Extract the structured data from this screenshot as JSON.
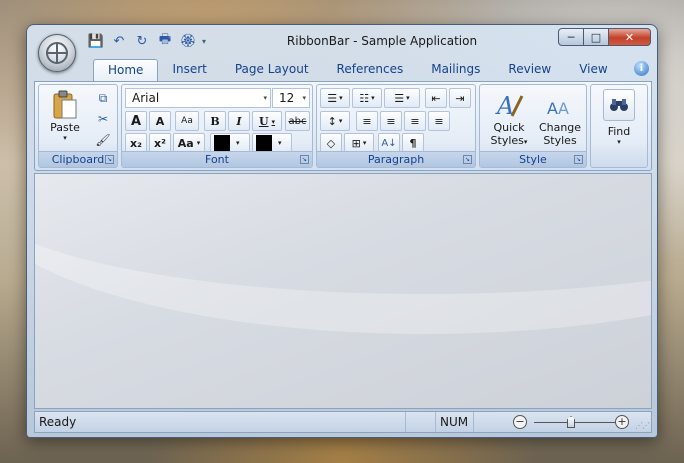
{
  "window": {
    "title": "RibbonBar - Sample Application"
  },
  "caption": {
    "minimize": "─",
    "maximize": "□",
    "close": "✕"
  },
  "qat": {
    "save": "💾",
    "undo": "↶",
    "redo": "↻",
    "print": "🖶",
    "award": "🏵",
    "customize": "▾"
  },
  "tabs": [
    {
      "label": "Home",
      "active": true
    },
    {
      "label": "Insert"
    },
    {
      "label": "Page Layout"
    },
    {
      "label": "References"
    },
    {
      "label": "Mailings"
    },
    {
      "label": "Review"
    },
    {
      "label": "View"
    }
  ],
  "help_glyph": "i",
  "clipboard": {
    "label": "Clipboard",
    "paste": "Paste",
    "paste_arrow": "▾",
    "copy": "⧉",
    "cut": "✂",
    "format_painter": "🖌"
  },
  "font": {
    "label": "Font",
    "family": "Arial",
    "size": "12",
    "grow": "A",
    "shrink": "A",
    "clear": "Aa",
    "bold": "B",
    "italic": "I",
    "underline": "U",
    "strike": "abc",
    "subscript": "x₂",
    "superscript": "x²",
    "change_case": "Aa",
    "highlight_color": "#000000",
    "font_color": "#000000",
    "arrow": "▾"
  },
  "paragraph": {
    "label": "Paragraph",
    "bullets": "☰",
    "numbering": "☷",
    "multilevel": "☰",
    "decrease_indent": "⇤",
    "increase_indent": "⇥",
    "line_spacing": "↕",
    "align_left": "≡",
    "align_center": "≡",
    "align_right": "≡",
    "justify": "≡",
    "shading": "◇",
    "borders": "⊞",
    "sort": "A↓",
    "show_marks": "¶",
    "arrow": "▾"
  },
  "style": {
    "label": "Style",
    "quick_styles": "Quick Styles",
    "quick_line1": "Quick",
    "quick_line2": "Styles",
    "change_line1": "Change",
    "change_line2": "Styles",
    "arrow": "▾"
  },
  "find": {
    "label": "Find",
    "arrow": "▾"
  },
  "launcher_glyph": "↘",
  "status": {
    "text": "Ready",
    "num": "NUM",
    "zoom_out": "−",
    "zoom_in": "+",
    "grip": "⋰⋰"
  },
  "colors": {
    "accent": "#15428b",
    "close": "#c1412c"
  }
}
